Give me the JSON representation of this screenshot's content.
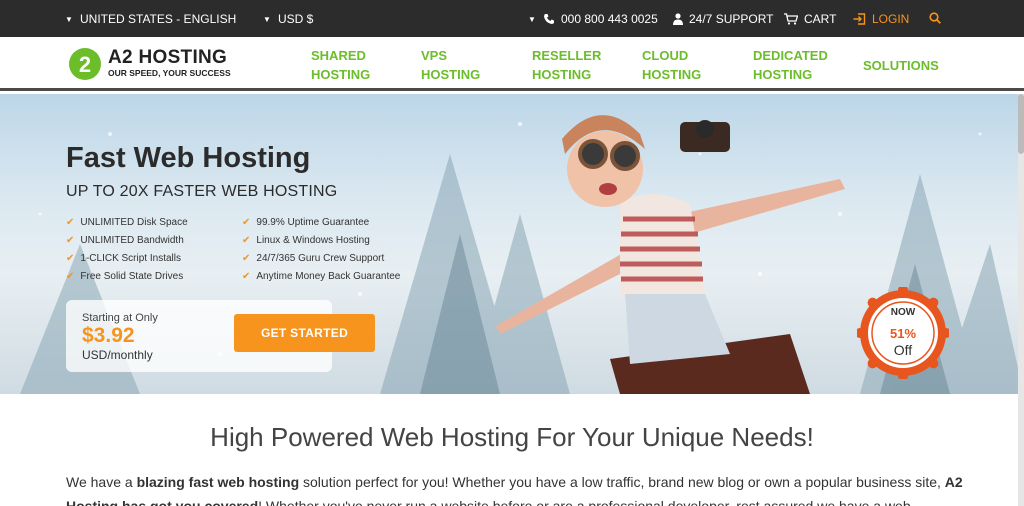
{
  "topbar": {
    "region": "UNITED STATES - ENGLISH",
    "currency": "USD $",
    "phone": "000 800 443 0025",
    "support": "24/7 SUPPORT",
    "cart": "CART",
    "login": "LOGIN"
  },
  "logo": {
    "title": "A2 HOSTING",
    "tagline": "OUR SPEED, YOUR SUCCESS"
  },
  "nav": [
    {
      "line1": "SHARED",
      "line2": "HOSTING"
    },
    {
      "line1": "VPS",
      "line2": "HOSTING"
    },
    {
      "line1": "RESELLER",
      "line2": "HOSTING"
    },
    {
      "line1": "CLOUD",
      "line2": "HOSTING"
    },
    {
      "line1": "DEDICATED",
      "line2": "HOSTING"
    },
    {
      "line1": "SOLUTIONS",
      "line2": ""
    }
  ],
  "hero": {
    "title": "Fast Web Hosting",
    "subtitle": "UP TO 20X FASTER WEB HOSTING",
    "features_left": [
      "UNLIMITED Disk Space",
      "UNLIMITED Bandwidth",
      "1-CLICK Script Installs",
      "Free Solid State Drives"
    ],
    "features_right": [
      "99.9% Uptime Guarantee",
      "Linux & Windows Hosting",
      "24/7/365 Guru Crew Support",
      "Anytime Money Back Guarantee"
    ],
    "price_label": "Starting at Only",
    "price": "$3.92",
    "price_unit": "USD",
    "price_period": "/monthly",
    "cta": "GET STARTED",
    "badge_now": "NOW",
    "badge_pct": "51%",
    "badge_off": "Off"
  },
  "content": {
    "headline": "High Powered Web Hosting For Your Unique Needs!",
    "p1_a": "We have a ",
    "p1_b": "blazing fast web hosting",
    "p1_c": " solution perfect for you! Whether you have a low traffic, brand new blog or own a popular business site, ",
    "p1_d": "A2 Hosting has got you covered",
    "p1_e": "! Whether you've never run a website before or are a professional developer, rest assured we have a web"
  },
  "colors": {
    "accent_orange": "#f7941d",
    "brand_green": "#6cbd2a",
    "topbar_bg": "#2c2c2c",
    "badge_red": "#e8561f"
  },
  "icons": [
    "chevron-down-icon",
    "phone-icon",
    "user-icon",
    "cart-icon",
    "login-icon",
    "search-icon",
    "check-icon"
  ]
}
